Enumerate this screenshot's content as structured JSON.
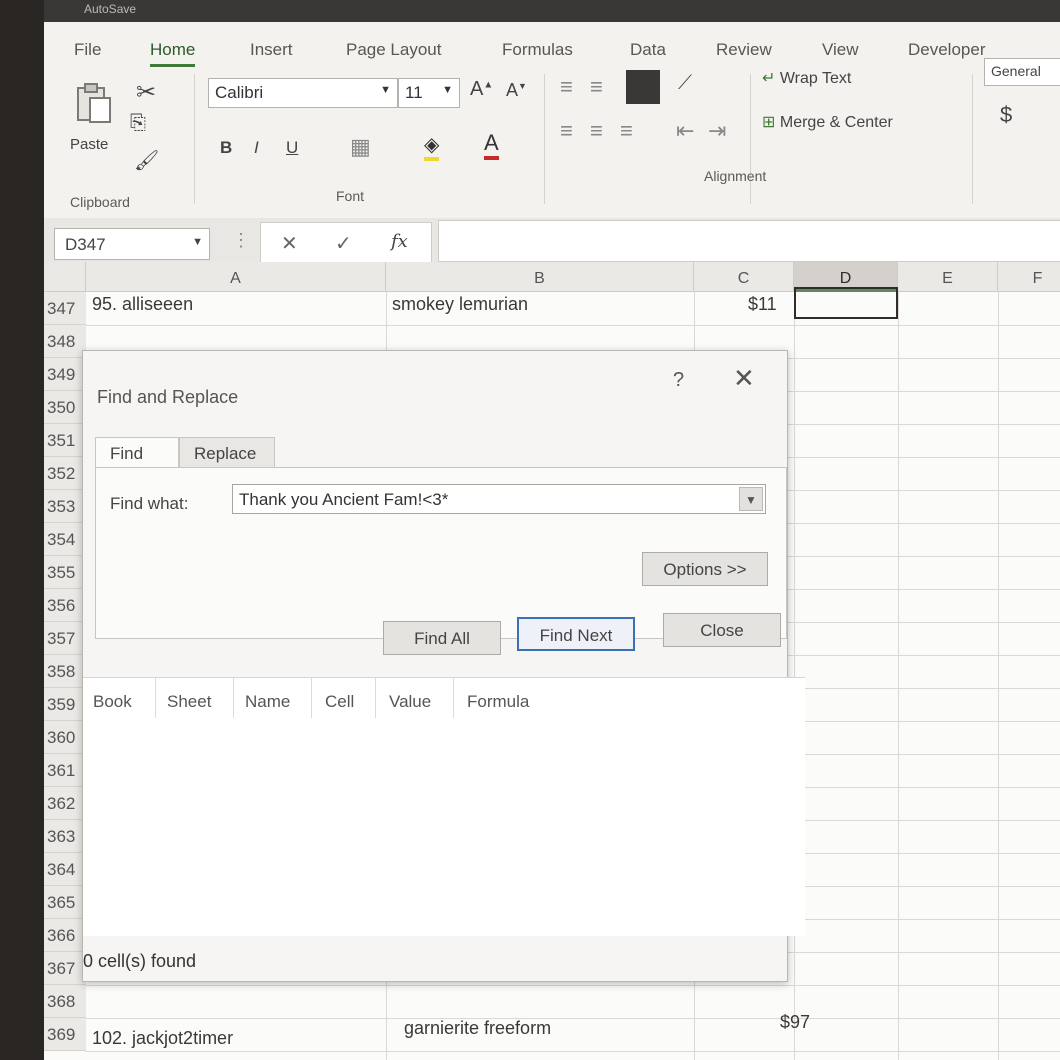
{
  "titlebar": {
    "text": "AutoSave"
  },
  "ribbon": {
    "tabs": [
      "File",
      "Home",
      "Insert",
      "Page Layout",
      "Formulas",
      "Data",
      "Review",
      "View",
      "Developer"
    ],
    "active_tab": "Home",
    "clipboard": {
      "paste_label": "Paste",
      "group_label": "Clipboard"
    },
    "font": {
      "name": "Calibri",
      "size": "11",
      "group_label": "Font",
      "bold": "B",
      "italic": "I",
      "underline": "U"
    },
    "alignment": {
      "wrap_text": "Wrap Text",
      "merge_center": "Merge & Center",
      "group_label": "Alignment"
    },
    "number": {
      "format": "General",
      "currency_symbol": "$"
    }
  },
  "formula_bar": {
    "name_box": "D347",
    "cancel": "✕",
    "enter": "✓",
    "fx": "fx",
    "value": ""
  },
  "grid": {
    "columns": [
      "A",
      "B",
      "C",
      "D",
      "E",
      "F"
    ],
    "selected_column": "D",
    "rows": [
      "347",
      "348",
      "349",
      "350",
      "351",
      "352",
      "353",
      "354",
      "355",
      "356",
      "357",
      "358",
      "359",
      "360",
      "361",
      "362",
      "363",
      "364",
      "365",
      "366",
      "367",
      "368",
      "369"
    ],
    "cells": {
      "a347": "95. alliseeen",
      "b347": "smokey lemurian",
      "c347": "$11",
      "a369": "102. jackjot2timer",
      "b369": "garnierite freeform",
      "c369": "$97"
    }
  },
  "dialog": {
    "title": "Find and Replace",
    "help": "?",
    "close_icon": "✕",
    "tabs": [
      "Find",
      "Replace"
    ],
    "active_tab": "Find",
    "find_label": "Find what:",
    "find_value": "Thank you Ancient Fam!<3*",
    "options_button": "Options >>",
    "find_all_button": "Find All",
    "find_next_button": "Find Next",
    "close_button": "Close",
    "result_columns": [
      "Book",
      "Sheet",
      "Name",
      "Cell",
      "Value",
      "Formula"
    ],
    "status": "0 cell(s) found"
  }
}
